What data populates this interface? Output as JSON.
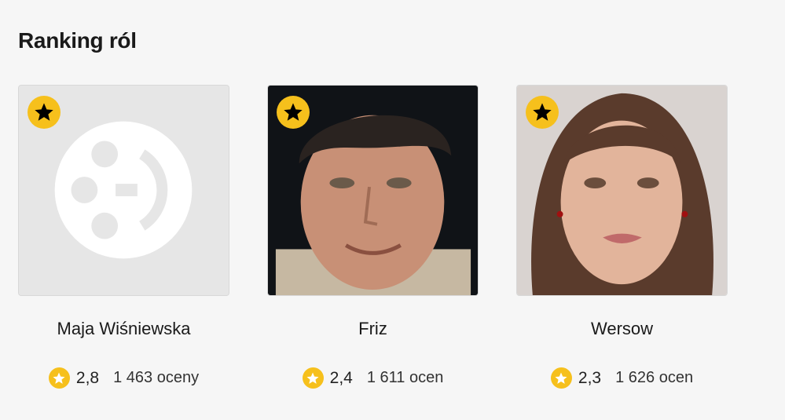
{
  "section": {
    "title": "Ranking ról"
  },
  "cards": [
    {
      "name": "Maja Wiśniewska",
      "rating": "2,8",
      "votes": "1 463 oceny",
      "image": "placeholder-film-icon"
    },
    {
      "name": "Friz",
      "rating": "2,4",
      "votes": "1 611 ocen",
      "image": "portrait-photo"
    },
    {
      "name": "Wersow",
      "rating": "2,3",
      "votes": "1 626 ocen",
      "image": "portrait-photo"
    }
  ],
  "colors": {
    "accent": "#f6c01c",
    "background": "#f6f6f6",
    "text": "#1a1a1a"
  },
  "icons": {
    "badge": "star-icon",
    "rating": "star-icon"
  }
}
